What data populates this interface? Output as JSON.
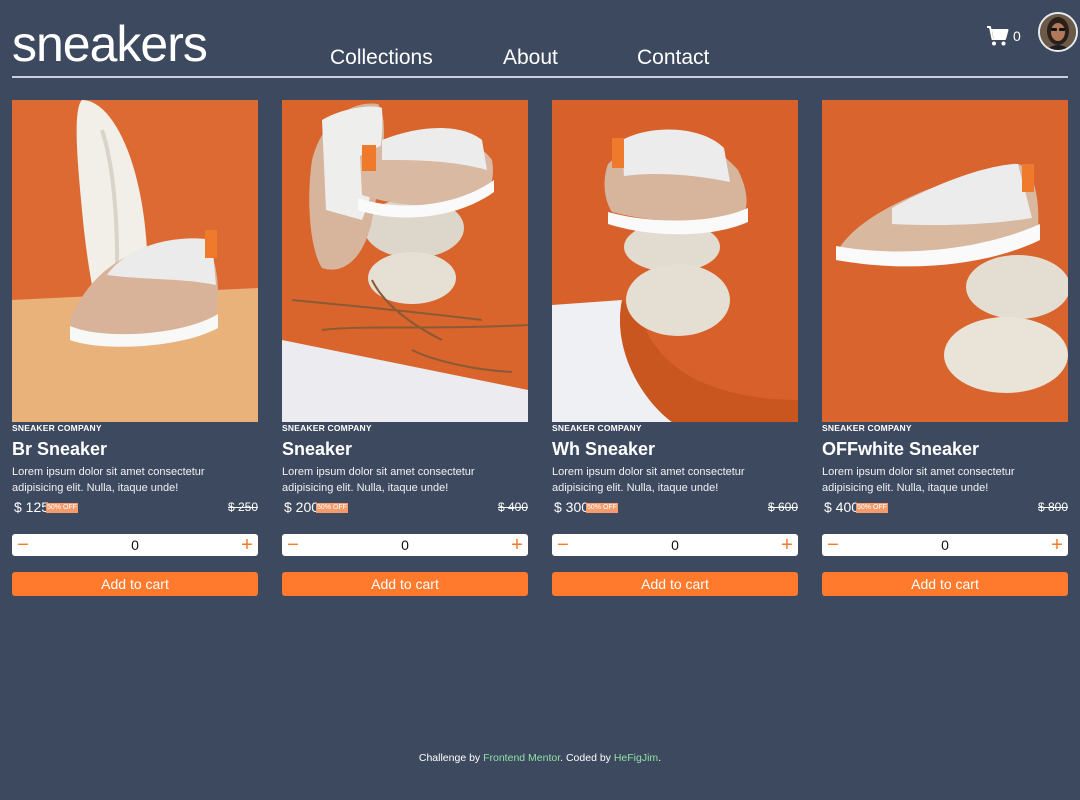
{
  "header": {
    "logo": "sneakers",
    "nav": [
      "Collections",
      "About",
      "Contact"
    ],
    "cart": {
      "icon": "cart-icon",
      "count": "0"
    },
    "avatar": {
      "icon": "user-avatar"
    }
  },
  "products": [
    {
      "company": "SNEAKER COMPANY",
      "name": "Br Sneaker",
      "description": "Lorem ipsum dolor sit amet consectetur adipisicing elit. Nulla, itaque unde!",
      "price": "$ 125",
      "discount": "50% OFF",
      "old_price": "$ 250",
      "qty_minus": "−",
      "quantity": "0",
      "qty_plus": "+",
      "add_label": "Add to cart"
    },
    {
      "company": "SNEAKER COMPANY",
      "name": "Sneaker",
      "description": "Lorem ipsum dolor sit amet consectetur adipisicing elit. Nulla, itaque unde!",
      "price": "$ 200",
      "discount": "50% OFF",
      "old_price": "$ 400",
      "qty_minus": "−",
      "quantity": "0",
      "qty_plus": "+",
      "add_label": "Add to cart"
    },
    {
      "company": "SNEAKER COMPANY",
      "name": "Wh Sneaker",
      "description": "Lorem ipsum dolor sit amet consectetur adipisicing elit. Nulla, itaque unde!",
      "price": "$ 300",
      "discount": "50% OFF",
      "old_price": "$ 600",
      "qty_minus": "−",
      "quantity": "0",
      "qty_plus": "+",
      "add_label": "Add to cart"
    },
    {
      "company": "SNEAKER COMPANY",
      "name": "OFFwhite Sneaker",
      "description": "Lorem ipsum dolor sit amet consectetur adipisicing elit. Nulla, itaque unde!",
      "price": "$ 400",
      "discount": "50% OFF",
      "old_price": "$ 800",
      "qty_minus": "−",
      "quantity": "0",
      "qty_plus": "+",
      "add_label": "Add to cart"
    }
  ],
  "footer": {
    "prefix": "Challenge by ",
    "link1": "Frontend Mentor",
    "middle": ". Coded by ",
    "link2": "HeFigJim",
    "suffix": "."
  },
  "colors": {
    "background": "#3d495e",
    "accent": "#ff7a2c",
    "badge": "#f59b6b",
    "footer_link": "#8fe0a6"
  }
}
